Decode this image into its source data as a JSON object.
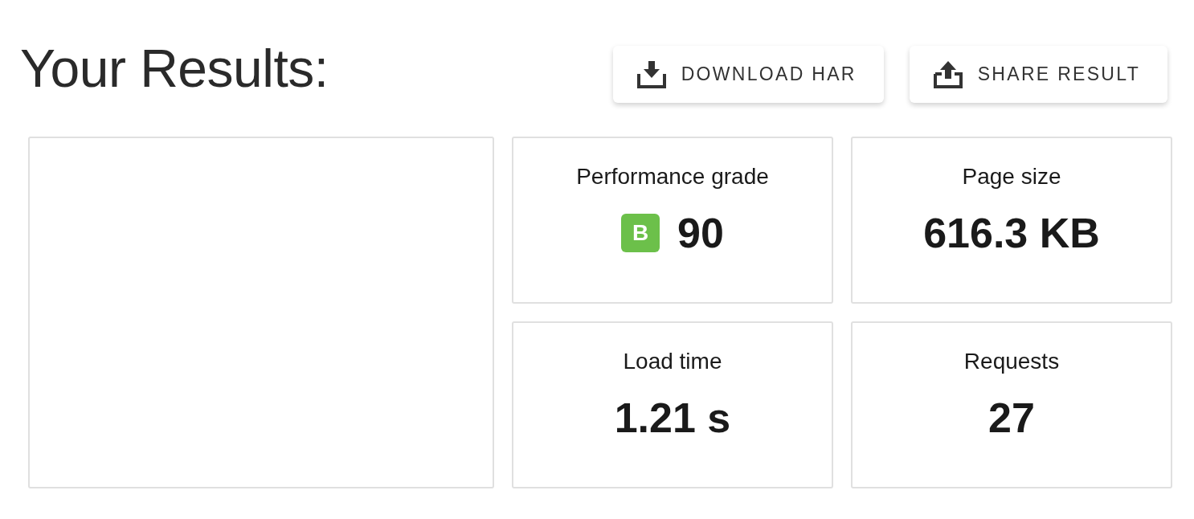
{
  "header": {
    "title": "Your Results:",
    "buttons": [
      {
        "label": "DOWNLOAD HAR",
        "kind": "download"
      },
      {
        "label": "SHARE RESULT",
        "kind": "share"
      }
    ]
  },
  "metrics": [
    {
      "label": "Performance grade",
      "value": "90",
      "grade": {
        "letter": "B",
        "color": "#6cc04a"
      }
    },
    {
      "label": "Page size",
      "value": "616.3 KB"
    },
    {
      "label": "Load time",
      "value": "1.21 s"
    },
    {
      "label": "Requests",
      "value": "27"
    }
  ]
}
